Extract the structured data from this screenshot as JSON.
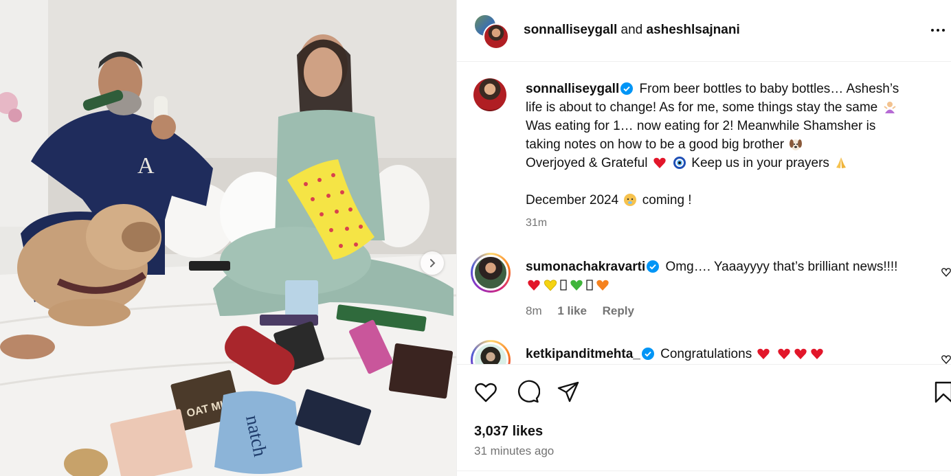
{
  "header": {
    "user1": "sonnalliseygall",
    "joiner": "and",
    "user2": "asheshlsajnani"
  },
  "caption": {
    "username": "sonnalliseygall",
    "line1": "From beer bottles to baby bottles… Ashesh’s",
    "line2": "life is about to change! As for me, some things stay the same",
    "line3": "Was eating for 1… now eating for 2! Meanwhile Shamsher is",
    "line4": "taking notes on how to be a good big brother",
    "line5a": "Overjoyed & Grateful",
    "line5b": "Keep us in your prayers",
    "line6a": "December 2024",
    "line6b": "coming !",
    "time": "31m"
  },
  "comments": [
    {
      "username": "sumonachakravarti",
      "text": "Omg…. Yaaayyyy that’s brilliant news!!!!",
      "time": "8m",
      "likes": "1 like",
      "reply": "Reply"
    },
    {
      "username": "ketkipanditmehta_",
      "text": "Congratulations"
    }
  ],
  "footer": {
    "likes": "3,037 likes",
    "posted": "31 minutes ago"
  },
  "icons": [
    "like-icon",
    "comment-icon",
    "share-icon",
    "save-icon",
    "more-icon",
    "verified-badge-icon",
    "next-arrow-icon"
  ],
  "colors": {
    "text": "#111111",
    "muted": "#737373",
    "verified": "#0095f6",
    "border": "#efefef"
  }
}
